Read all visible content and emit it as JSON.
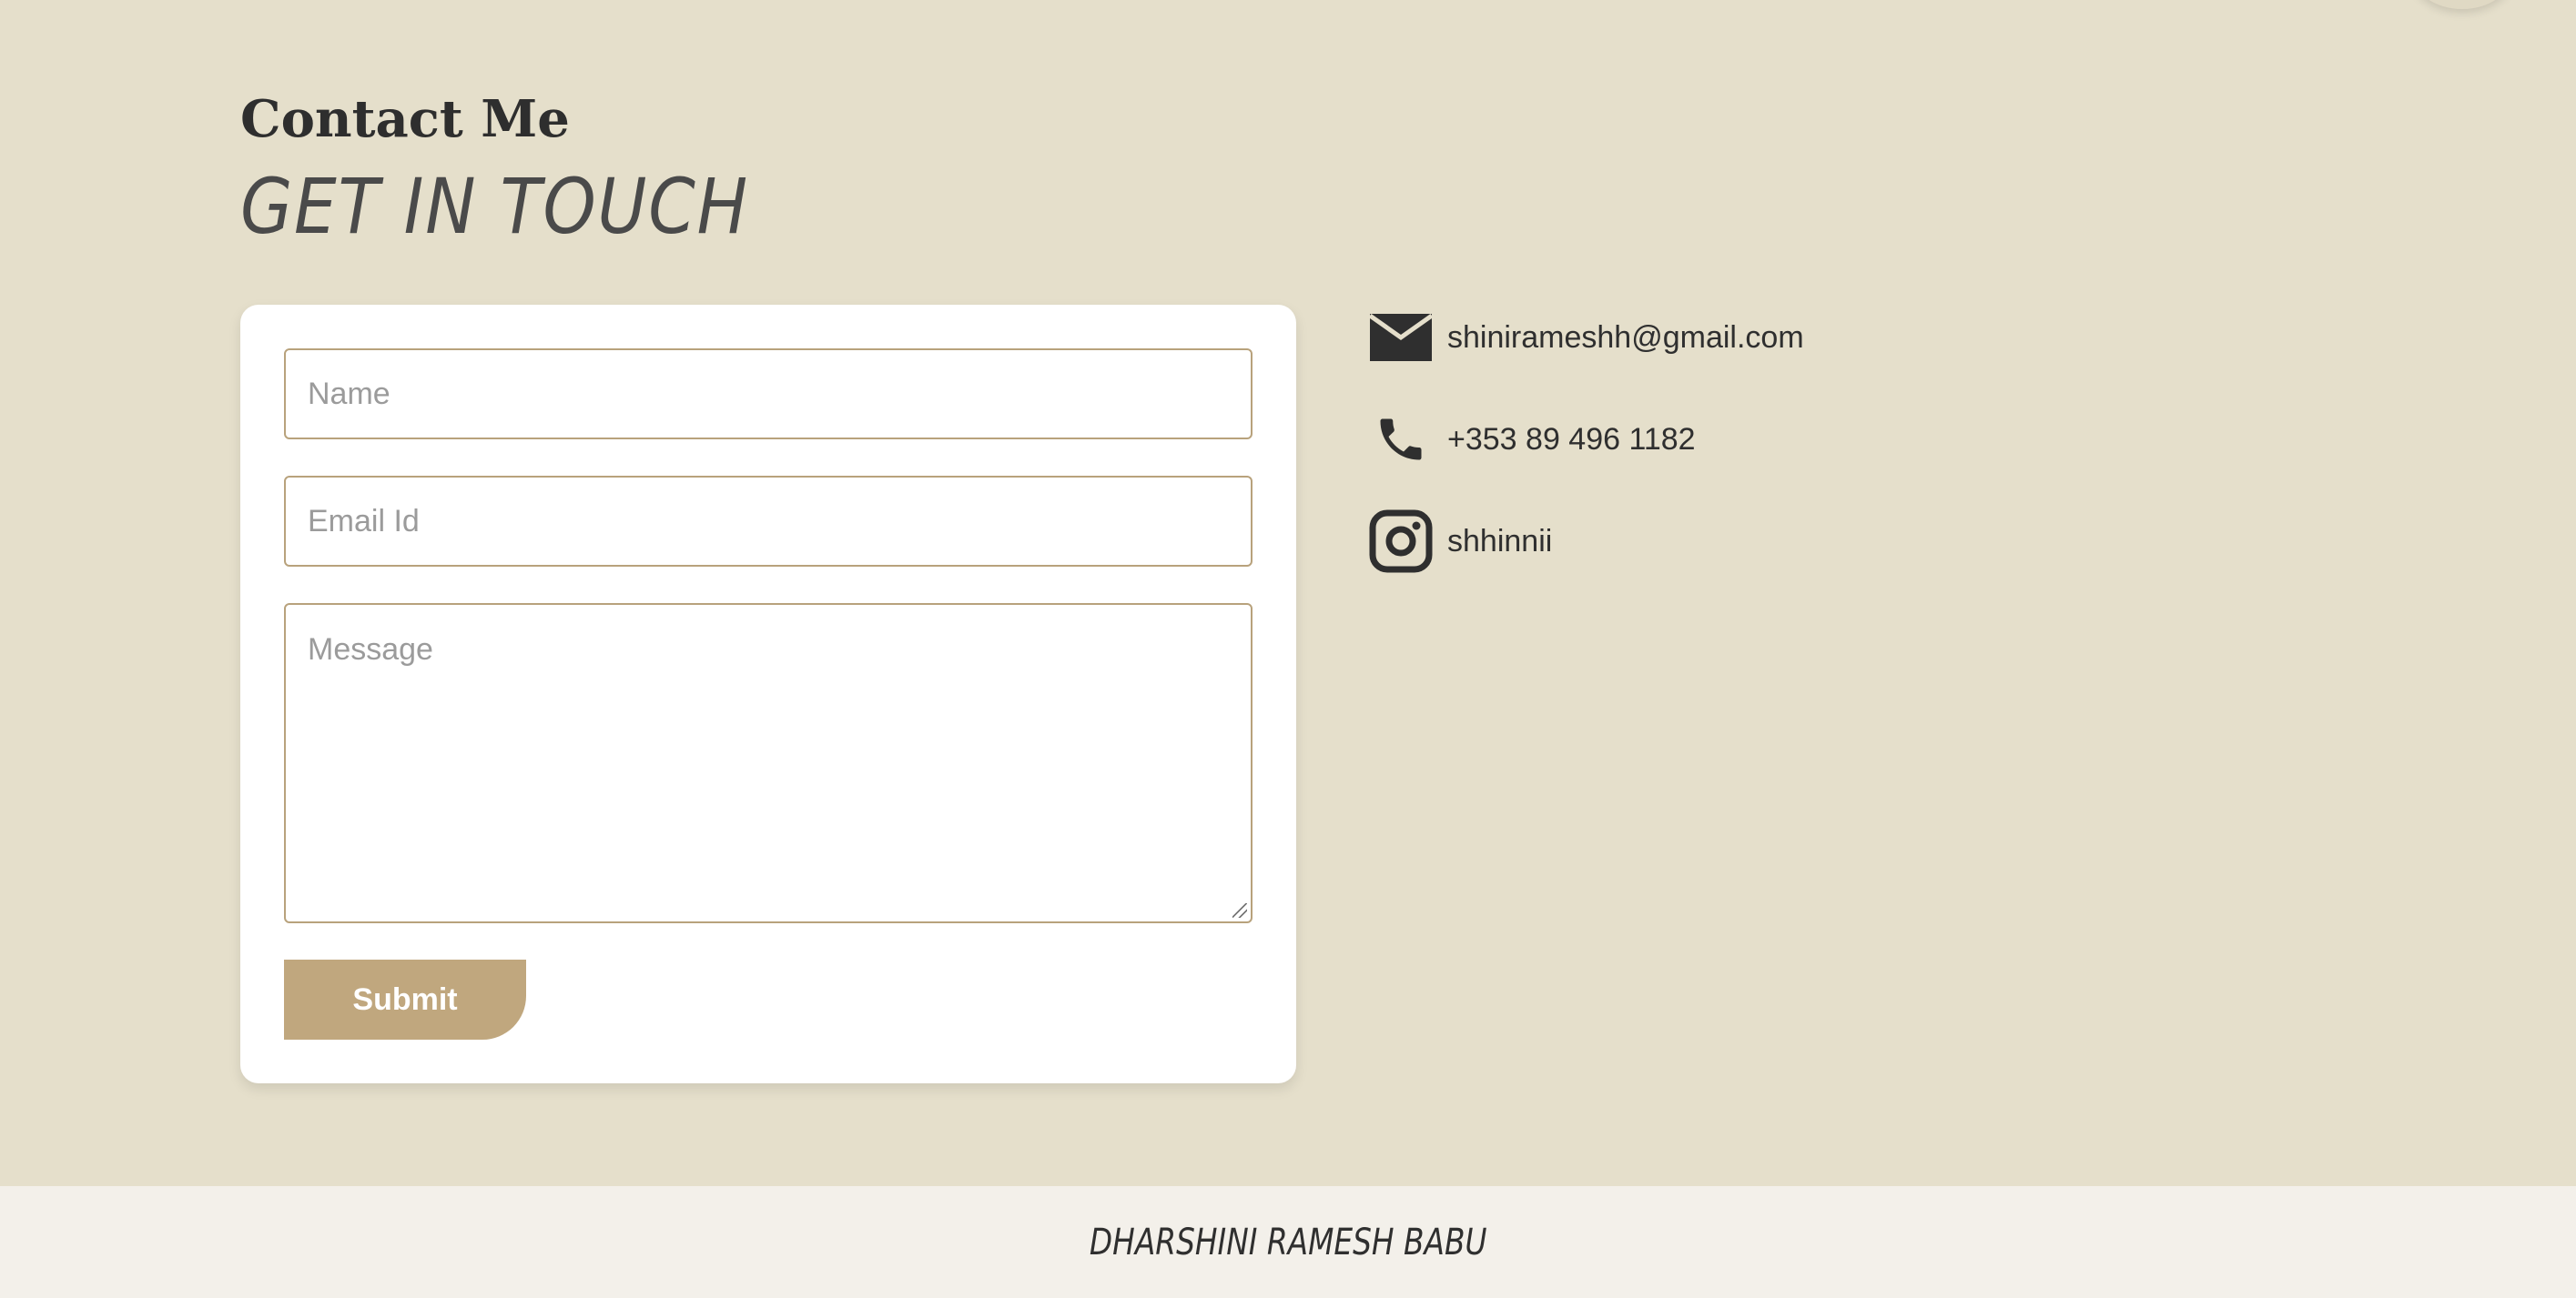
{
  "header": {
    "subtitle": "Contact Me",
    "title": "GET IN TOUCH"
  },
  "form": {
    "name_placeholder": "Name",
    "email_placeholder": "Email Id",
    "message_placeholder": "Message",
    "submit_label": "Submit"
  },
  "contact": {
    "email": {
      "icon": "mail-icon",
      "text": "shinirameshh@gmail.com"
    },
    "phone": {
      "icon": "phone-icon",
      "text": "+353 89 496 1182"
    },
    "instagram": {
      "icon": "instagram-icon",
      "text": "shhinnii"
    }
  },
  "footer": {
    "text": "DHARSHINI RAMESH BABU"
  },
  "colors": {
    "background": "#e5dfcb",
    "accent": "#c0a77e",
    "card": "#ffffff",
    "footer": "#f3f0ea"
  }
}
